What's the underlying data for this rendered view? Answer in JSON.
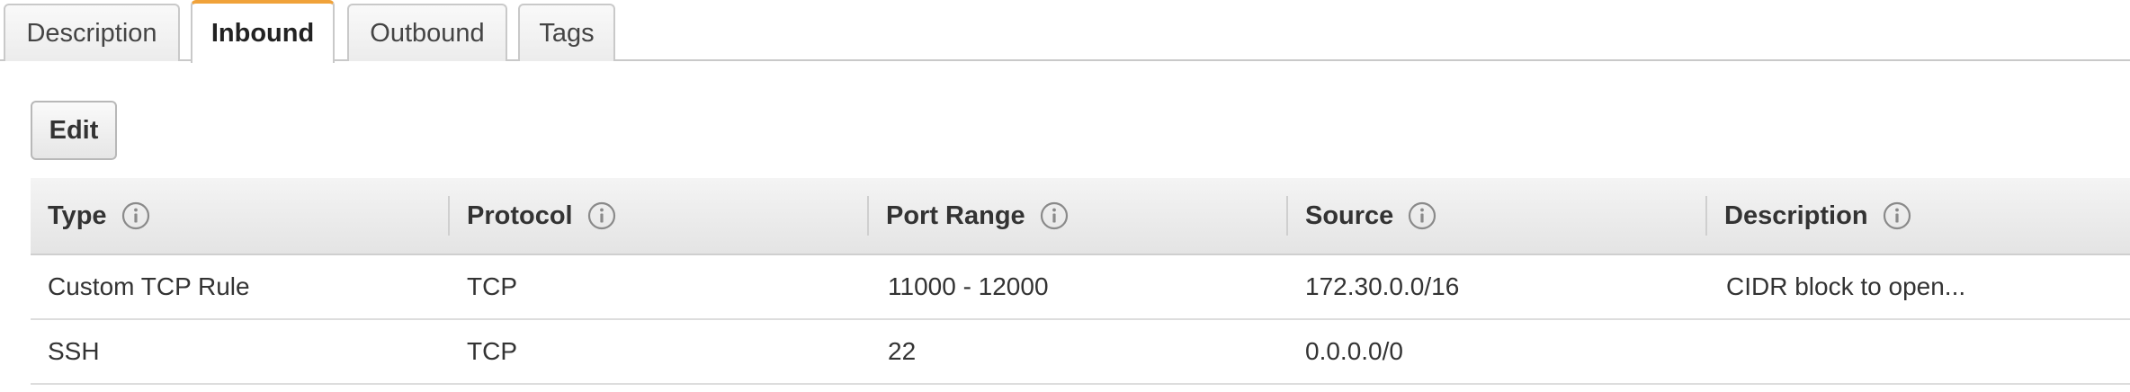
{
  "tabs": [
    {
      "label": "Description",
      "active": false
    },
    {
      "label": "Inbound",
      "active": true
    },
    {
      "label": "Outbound",
      "active": false
    },
    {
      "label": "Tags",
      "active": false
    }
  ],
  "toolbar": {
    "edit_label": "Edit"
  },
  "table": {
    "columns": [
      {
        "label": "Type",
        "info_icon": "info-icon"
      },
      {
        "label": "Protocol",
        "info_icon": "info-icon"
      },
      {
        "label": "Port Range",
        "info_icon": "info-icon"
      },
      {
        "label": "Source",
        "info_icon": "info-icon"
      },
      {
        "label": "Description",
        "info_icon": "info-icon"
      }
    ],
    "rows": [
      [
        "Custom TCP Rule",
        "TCP",
        "11000 - 12000",
        "172.30.0.0/16",
        "CIDR block to open..."
      ],
      [
        "SSH",
        "TCP",
        "22",
        "0.0.0.0/0",
        ""
      ]
    ]
  },
  "colors": {
    "active_tab_accent": "#f0a23a",
    "header_bg": "#e8e8e8",
    "border": "#c9c9c9"
  }
}
